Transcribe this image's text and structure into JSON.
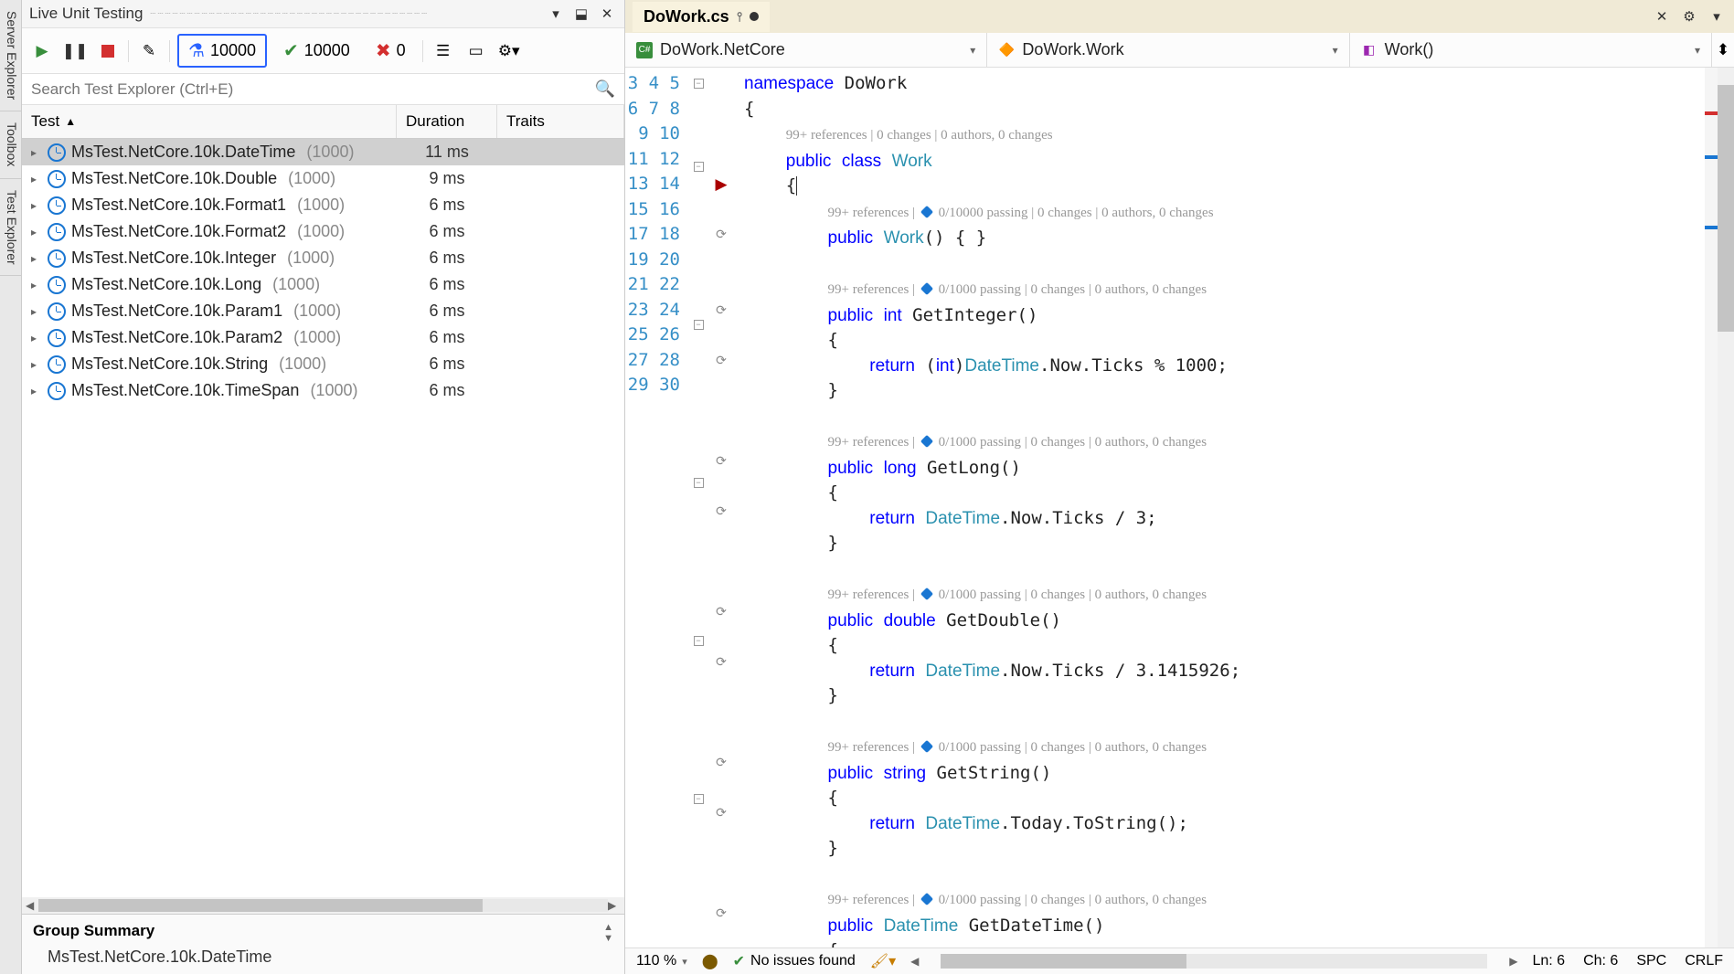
{
  "side_tabs": [
    "Server Explorer",
    "Toolbox",
    "Test Explorer"
  ],
  "test_panel": {
    "title": "Live Unit Testing",
    "counters": {
      "running": "10000",
      "passed": "10000",
      "failed": "0"
    },
    "search_placeholder": "Search Test Explorer (Ctrl+E)",
    "columns": {
      "test": "Test",
      "duration": "Duration",
      "traits": "Traits"
    },
    "tests": [
      {
        "name": "MsTest.NetCore.10k.DateTime",
        "count": "(1000)",
        "duration": "11 ms",
        "selected": true
      },
      {
        "name": "MsTest.NetCore.10k.Double",
        "count": "(1000)",
        "duration": "9 ms"
      },
      {
        "name": "MsTest.NetCore.10k.Format1",
        "count": "(1000)",
        "duration": "6 ms"
      },
      {
        "name": "MsTest.NetCore.10k.Format2",
        "count": "(1000)",
        "duration": "6 ms"
      },
      {
        "name": "MsTest.NetCore.10k.Integer",
        "count": "(1000)",
        "duration": "6 ms"
      },
      {
        "name": "MsTest.NetCore.10k.Long",
        "count": "(1000)",
        "duration": "6 ms"
      },
      {
        "name": "MsTest.NetCore.10k.Param1",
        "count": "(1000)",
        "duration": "6 ms"
      },
      {
        "name": "MsTest.NetCore.10k.Param2",
        "count": "(1000)",
        "duration": "6 ms"
      },
      {
        "name": "MsTest.NetCore.10k.String",
        "count": "(1000)",
        "duration": "6 ms"
      },
      {
        "name": "MsTest.NetCore.10k.TimeSpan",
        "count": "(1000)",
        "duration": "6 ms"
      }
    ],
    "summary": {
      "title": "Group Summary",
      "body": "MsTest.NetCore.10k.DateTime"
    }
  },
  "editor": {
    "tab": "DoWork.cs",
    "nav": {
      "project": "DoWork.NetCore",
      "class": "DoWork.Work",
      "method": "Work()"
    },
    "lines": [
      3,
      4,
      5,
      6,
      7,
      8,
      9,
      10,
      11,
      12,
      13,
      14,
      15,
      16,
      17,
      18,
      19,
      20,
      21,
      22,
      23,
      24,
      25,
      26,
      27,
      28,
      29,
      30
    ],
    "codelens": {
      "l5": "99+ references | 0 changes | 0 authors, 0 changes",
      "l7": "99+ references |  0/10000 passing | 0 changes | 0 authors, 0 changes",
      "l9": "99+ references |  0/1000 passing | 0 changes | 0 authors, 0 changes",
      "l14": "99+ references |  0/1000 passing | 0 changes | 0 authors, 0 changes",
      "l19": "99+ references |  0/1000 passing | 0 changes | 0 authors, 0 changes",
      "l24": "99+ references |  0/1000 passing | 0 changes | 0 authors, 0 changes",
      "l29": "99+ references |  0/1000 passing | 0 changes | 0 authors, 0 changes"
    },
    "status": {
      "zoom": "110 %",
      "issues": "No issues found",
      "line": "Ln: 6",
      "col": "Ch: 6",
      "spc": "SPC",
      "eol": "CRLF"
    }
  }
}
